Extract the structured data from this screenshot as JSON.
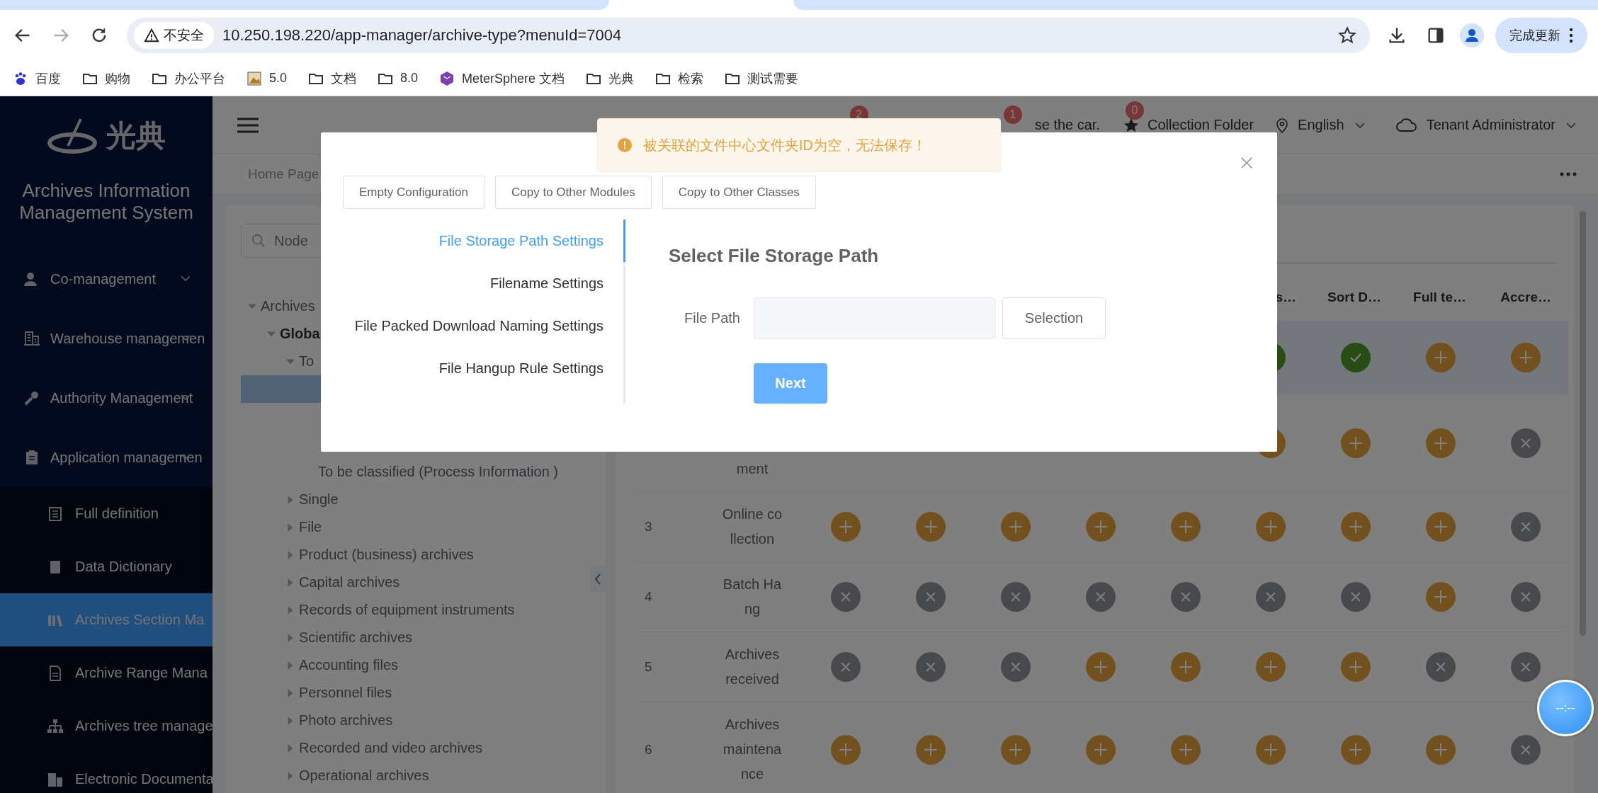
{
  "browser": {
    "security_label": "不安全",
    "url": "10.250.198.220/app-manager/archive-type?menuId=7004",
    "update_button": "完成更新",
    "bookmarks": [
      {
        "label": "百度",
        "kind": "paw"
      },
      {
        "label": "购物",
        "kind": "folder"
      },
      {
        "label": "办公平台",
        "kind": "folder"
      },
      {
        "label": "5.0",
        "kind": "image"
      },
      {
        "label": "文档",
        "kind": "folder"
      },
      {
        "label": "8.0",
        "kind": "folder"
      },
      {
        "label": "MeterSphere 文档",
        "kind": "app"
      },
      {
        "label": "光典",
        "kind": "folder"
      },
      {
        "label": "检索",
        "kind": "folder"
      },
      {
        "label": "测试需要",
        "kind": "folder"
      }
    ]
  },
  "sidebar": {
    "logo": "光典",
    "title": "Archives Information Management System",
    "menu": [
      {
        "label": "Co-management",
        "kind": "user"
      },
      {
        "label": "Warehouse managemen",
        "kind": "building"
      },
      {
        "label": "Authority Management",
        "kind": "key"
      },
      {
        "label": "Application managemen",
        "kind": "clipboard"
      }
    ],
    "submenu": [
      {
        "label": "Full definition",
        "kind": "list",
        "selected": false
      },
      {
        "label": "Data Dictionary",
        "kind": "book",
        "selected": false
      },
      {
        "label": "Archives Section Ma",
        "kind": "books",
        "selected": true
      },
      {
        "label": "Archive Range Mana",
        "kind": "file",
        "selected": false
      },
      {
        "label": "Archives tree manage",
        "kind": "tree",
        "selected": false
      },
      {
        "label": "Electronic Documenta",
        "kind": "office",
        "selected": false
      }
    ]
  },
  "header": {
    "alerts": [
      {
        "badge": "2"
      },
      {
        "badge": "1",
        "label": "se the car."
      }
    ],
    "collection": {
      "badge": "0",
      "label": "Collection Folder"
    },
    "language": "English",
    "user": "Tenant Administrator"
  },
  "breadcrumb": {
    "label": "Home Page"
  },
  "tree": {
    "search_placeholder": "Node",
    "nodes": [
      {
        "label": "Archives",
        "expanded": true,
        "selected": false,
        "children": [
          {
            "label": "Globa",
            "expanded": true,
            "selected": false,
            "children": [
              {
                "label": "To",
                "expanded": true,
                "selected": false,
                "children": [
                  {
                    "selected": true
                  },
                  {
                    "selected": false
                  },
                  {
                    "selected": false
                  },
                  {
                    "label": "To be classified (Process Information )",
                    "selected": false
                  }
                ]
              },
              {
                "label": "Single",
                "expanded": false,
                "selected": false
              },
              {
                "label": "File",
                "expanded": false,
                "selected": false
              },
              {
                "label": "Product (business) archives",
                "expanded": false,
                "selected": false
              },
              {
                "label": "Capital archives",
                "expanded": false,
                "selected": false
              },
              {
                "label": "Records of equipment instruments",
                "expanded": false,
                "selected": false
              },
              {
                "label": "Scientific archives",
                "expanded": false,
                "selected": false
              },
              {
                "label": "Accounting files",
                "expanded": false,
                "selected": false
              },
              {
                "label": "Personnel files",
                "expanded": false,
                "selected": false
              },
              {
                "label": "Photo archives",
                "expanded": false,
                "selected": false
              },
              {
                "label": "Recorded and video archives",
                "expanded": false,
                "selected": false
              },
              {
                "label": "Operational archives",
                "expanded": false,
                "selected": false
              }
            ]
          }
        ]
      }
    ]
  },
  "table": {
    "columns": [
      null,
      null,
      null,
      null,
      null,
      "s…",
      "Sort D…",
      "Full te…",
      "Accre…"
    ],
    "rows": [
      {
        "selected": true,
        "cells": [
          null,
          null,
          null,
          null,
          null,
          {
            "kind": "check"
          },
          {
            "kind": "check"
          },
          {
            "kind": "plus"
          },
          {
            "kind": "plus"
          }
        ]
      },
      {
        "selected": false,
        "name": "ment",
        "cells": [
          null,
          null,
          null,
          null,
          null,
          {
            "kind": "plus"
          },
          {
            "kind": "plus"
          },
          {
            "kind": "plus"
          },
          {
            "kind": "cross"
          }
        ]
      },
      {
        "selected": false,
        "number": "3",
        "name": "Online collection",
        "cells": [
          {
            "kind": "plus"
          },
          {
            "kind": "plus"
          },
          {
            "kind": "plus"
          },
          {
            "kind": "plus"
          },
          {
            "kind": "plus"
          },
          {
            "kind": "plus"
          },
          {
            "kind": "plus"
          },
          {
            "kind": "plus"
          },
          {
            "kind": "cross"
          }
        ]
      },
      {
        "selected": false,
        "number": "4",
        "name": "Batch Hang",
        "cells": [
          {
            "kind": "cross"
          },
          {
            "kind": "cross"
          },
          {
            "kind": "cross"
          },
          {
            "kind": "cross"
          },
          {
            "kind": "cross"
          },
          {
            "kind": "cross"
          },
          {
            "kind": "cross"
          },
          {
            "kind": "plus"
          },
          {
            "kind": "cross"
          }
        ]
      },
      {
        "selected": false,
        "number": "5",
        "name": "Archives received",
        "cells": [
          {
            "kind": "cross"
          },
          {
            "kind": "cross"
          },
          {
            "kind": "cross"
          },
          {
            "kind": "plus"
          },
          {
            "kind": "plus"
          },
          {
            "kind": "plus"
          },
          {
            "kind": "plus"
          },
          {
            "kind": "cross"
          },
          {
            "kind": "cross"
          }
        ]
      },
      {
        "selected": false,
        "number": "6",
        "name": "Archives maintenance",
        "cells": [
          {
            "kind": "plus"
          },
          {
            "kind": "plus"
          },
          {
            "kind": "plus"
          },
          {
            "kind": "plus"
          },
          {
            "kind": "plus"
          },
          {
            "kind": "plus"
          },
          {
            "kind": "plus"
          },
          {
            "kind": "plus"
          },
          {
            "kind": "cross"
          }
        ]
      }
    ]
  },
  "modal": {
    "actions": [
      "Empty Configuration",
      "Copy to Other Modules",
      "Copy to Other Classes"
    ],
    "steps": [
      {
        "label": "File Storage Path Settings",
        "selected": true
      },
      {
        "label": "Filename Settings",
        "selected": false
      },
      {
        "label": "File Packed Download Naming Settings",
        "selected": false
      },
      {
        "label": "File Hangup Rule Settings",
        "selected": false
      }
    ],
    "heading": "Select File Storage Path",
    "field_label": "File Path",
    "select_button": "Selection",
    "next_button": "Next"
  },
  "toast": {
    "kind": "warning",
    "message": "被关联的文件中心文件夹ID为空，无法保存！"
  },
  "timer": {
    "text": "--:--"
  }
}
